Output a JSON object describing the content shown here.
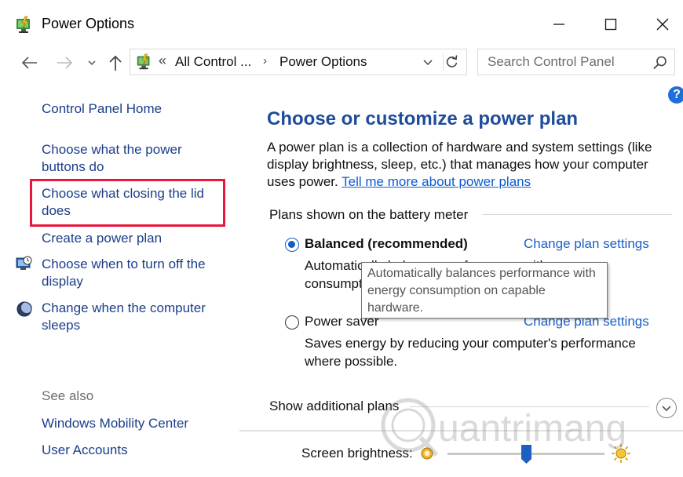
{
  "window": {
    "title": "Power Options",
    "controls": {
      "minimize": "minimize",
      "maximize": "maximize",
      "close": "close"
    }
  },
  "address": {
    "prefix": "«",
    "crumbs": [
      "All Control ...",
      "Power Options"
    ],
    "separator": "›"
  },
  "search": {
    "placeholder": "Search Control Panel"
  },
  "help": {
    "label": "?"
  },
  "sidebar": {
    "home": "Control Panel Home",
    "links": [
      "Choose what the power buttons do",
      "Choose what closing the lid does",
      "Create a power plan",
      "Choose when to turn off the display",
      "Change when the computer sleeps"
    ],
    "see_also": "See also",
    "see_also_links": [
      "Windows Mobility Center",
      "User Accounts"
    ]
  },
  "main": {
    "title": "Choose or customize a power plan",
    "description": "A power plan is a collection of hardware and system settings (like display brightness, sleep, etc.) that manages how your computer uses power.",
    "description_link": "Tell me more about power plans",
    "plans_heading": "Plans shown on the battery meter",
    "plans": [
      {
        "name": "Balanced (recommended)",
        "selected": true,
        "link": "Change plan settings",
        "description": "Automatically balances performance with energy consumption on capable hardware."
      },
      {
        "name": "Power saver",
        "selected": false,
        "link": "Change plan settings",
        "description": "Saves energy by reducing your computer's performance where possible."
      }
    ],
    "tooltip": "Automatically balances performance with energy consumption on capable hardware.",
    "more_plans": "Show additional plans",
    "brightness_label": "Screen brightness:",
    "brightness_level": 0.5
  },
  "watermark": {
    "text": "uantrimang"
  },
  "colors": {
    "link": "#1b3e8a",
    "title_blue": "#1e4c9a",
    "highlight": "#e8173c",
    "accent": "#0f5fc6"
  },
  "icons": {
    "title": "power-options-icon",
    "display": "monitor-clock-icon",
    "sleep": "moon-icon",
    "search": "search-icon",
    "refresh": "refresh-icon"
  }
}
